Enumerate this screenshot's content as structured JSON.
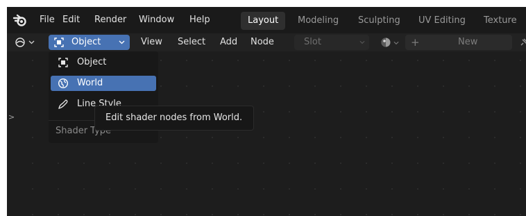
{
  "menu": {
    "items": [
      "File",
      "Edit",
      "Render",
      "Window",
      "Help"
    ]
  },
  "workspaces": {
    "tabs": [
      "Layout",
      "Modeling",
      "Sculpting",
      "UV Editing",
      "Texture P"
    ],
    "active": "Layout"
  },
  "header": {
    "shader_type": "Object",
    "view": "View",
    "select": "Select",
    "add": "Add",
    "node": "Node",
    "slot": "Slot",
    "new_label": "New"
  },
  "dropdown": {
    "items": [
      {
        "label": "Object",
        "icon": "object-icon"
      },
      {
        "label": "World",
        "icon": "world-icon"
      },
      {
        "label": "Line Style",
        "icon": "line-style-icon"
      }
    ],
    "selected": "World",
    "heading": "Shader Type"
  },
  "tooltip": {
    "text": "Edit shader nodes from World."
  },
  "colors": {
    "accent": "#4772b3",
    "background": "#1d1d1d",
    "menu_bg": "#181818"
  }
}
